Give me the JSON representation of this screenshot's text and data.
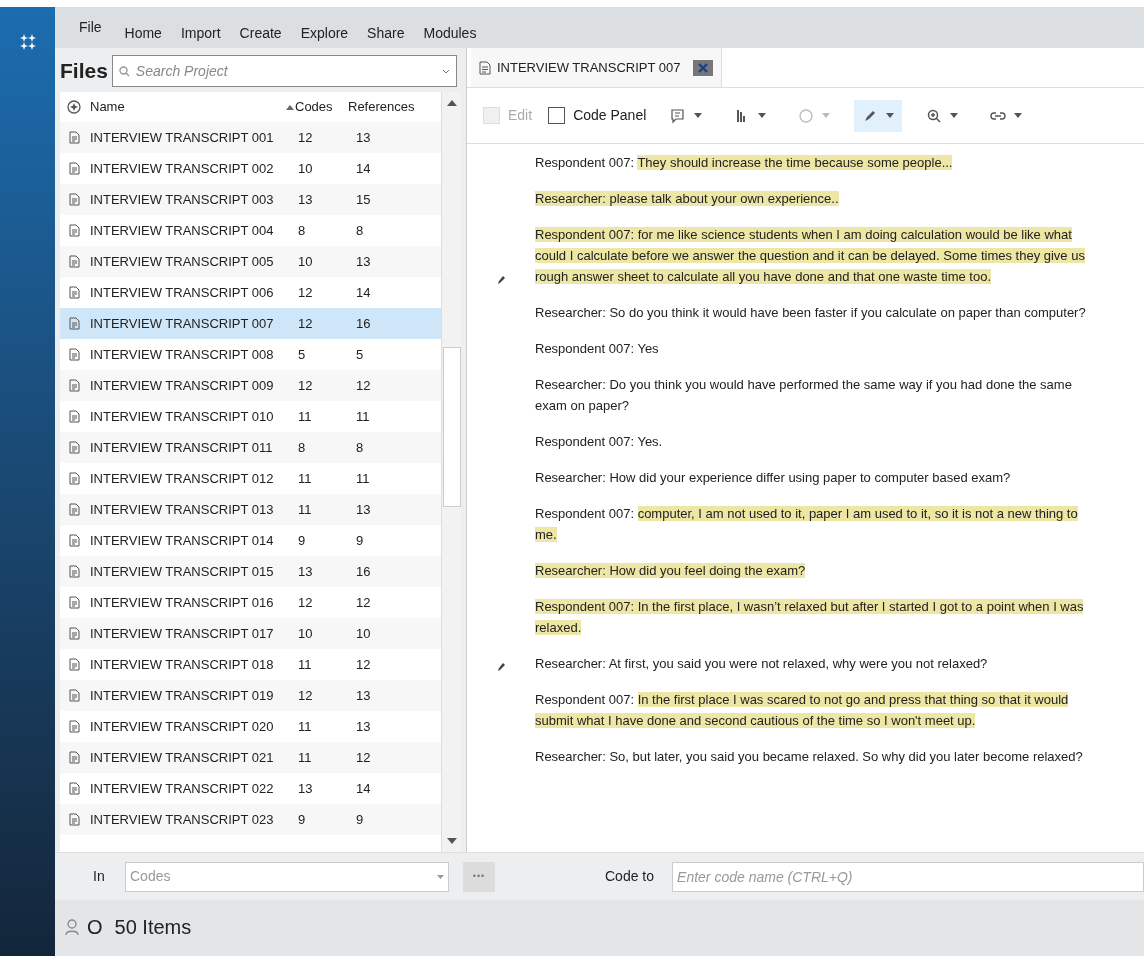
{
  "menu": [
    "File",
    "Home",
    "Import",
    "Create",
    "Explore",
    "Share",
    "Modules"
  ],
  "files": {
    "title": "Files",
    "search": {
      "placeholder": "Search Project"
    },
    "columns": [
      {
        "label": "Name",
        "sorted": false
      },
      {
        "label": "Codes",
        "sorted": true
      },
      {
        "label": "References",
        "sorted": false
      }
    ],
    "rows": [
      {
        "name": "INTERVIEW TRANSCRIPT 001",
        "codes": "12",
        "references": "13",
        "selected": false
      },
      {
        "name": "INTERVIEW TRANSCRIPT 002",
        "codes": "10",
        "references": "14",
        "selected": false
      },
      {
        "name": "INTERVIEW TRANSCRIPT 003",
        "codes": "13",
        "references": "15",
        "selected": false
      },
      {
        "name": "INTERVIEW TRANSCRIPT 004",
        "codes": "8",
        "references": "8",
        "selected": false
      },
      {
        "name": "INTERVIEW TRANSCRIPT 005",
        "codes": "10",
        "references": "13",
        "selected": false
      },
      {
        "name": "INTERVIEW TRANSCRIPT 006",
        "codes": "12",
        "references": "14",
        "selected": false
      },
      {
        "name": "INTERVIEW TRANSCRIPT 007",
        "codes": "12",
        "references": "16",
        "selected": true
      },
      {
        "name": "INTERVIEW TRANSCRIPT 008",
        "codes": "5",
        "references": "5",
        "selected": false
      },
      {
        "name": "INTERVIEW TRANSCRIPT 009",
        "codes": "12",
        "references": "12",
        "selected": false
      },
      {
        "name": "INTERVIEW TRANSCRIPT 010",
        "codes": "11",
        "references": "11",
        "selected": false
      },
      {
        "name": "INTERVIEW TRANSCRIPT 011",
        "codes": "8",
        "references": "8",
        "selected": false
      },
      {
        "name": "INTERVIEW TRANSCRIPT 012",
        "codes": "11",
        "references": "11",
        "selected": false
      },
      {
        "name": "INTERVIEW TRANSCRIPT 013",
        "codes": "11",
        "references": "13",
        "selected": false
      },
      {
        "name": "INTERVIEW TRANSCRIPT 014",
        "codes": "9",
        "references": "9",
        "selected": false
      },
      {
        "name": "INTERVIEW TRANSCRIPT 015",
        "codes": "13",
        "references": "16",
        "selected": false
      },
      {
        "name": "INTERVIEW TRANSCRIPT 016",
        "codes": "12",
        "references": "12",
        "selected": false
      },
      {
        "name": "INTERVIEW TRANSCRIPT 017",
        "codes": "10",
        "references": "10",
        "selected": false
      },
      {
        "name": "INTERVIEW TRANSCRIPT 018",
        "codes": "11",
        "references": "12",
        "selected": false
      },
      {
        "name": "INTERVIEW TRANSCRIPT 019",
        "codes": "12",
        "references": "13",
        "selected": false
      },
      {
        "name": "INTERVIEW TRANSCRIPT 020",
        "codes": "11",
        "references": "13",
        "selected": false
      },
      {
        "name": "INTERVIEW TRANSCRIPT 021",
        "codes": "11",
        "references": "12",
        "selected": false
      },
      {
        "name": "INTERVIEW TRANSCRIPT 022",
        "codes": "13",
        "references": "14",
        "selected": false
      },
      {
        "name": "INTERVIEW TRANSCRIPT 023",
        "codes": "9",
        "references": "9",
        "selected": false
      }
    ]
  },
  "document_tab": {
    "title": "INTERVIEW TRANSCRIPT 007",
    "selected": true
  },
  "toolbar": {
    "edit": {
      "label": "Edit",
      "checked": false,
      "disabled": true
    },
    "code_panel": {
      "label": "Code Panel",
      "checked": false
    },
    "tools": [
      {
        "kind": "memo",
        "disabled": false,
        "selected": false
      },
      {
        "kind": "stripes",
        "disabled": false,
        "selected": false
      },
      {
        "kind": "circle",
        "disabled": true,
        "selected": false
      },
      {
        "kind": "highlight",
        "disabled": false,
        "selected": true
      },
      {
        "kind": "zoom",
        "disabled": false,
        "selected": false
      },
      {
        "kind": "link",
        "disabled": false,
        "selected": false
      }
    ]
  },
  "paragraphs": [
    {
      "annotated": false,
      "segments": [
        {
          "text": "Respondent 007: ",
          "highlighted": false
        },
        {
          "text": "They should increase the time because some people...",
          "highlighted": true
        }
      ]
    },
    {
      "annotated": false,
      "segments": [
        {
          "text": "Researcher: please talk about your own experience..",
          "highlighted": true
        }
      ]
    },
    {
      "annotated": true,
      "segments": [
        {
          "text": " Respondent 007: for me like science students when I am doing calculation would be like what could I calculate before we answer the question and it can be delayed. Some times they give us rough answer sheet to calculate all you have done and that one waste time too.",
          "highlighted": true
        }
      ]
    },
    {
      "annotated": false,
      "segments": [
        {
          "text": "Researcher: So do you think it would have been faster if you calculate on paper than computer?",
          "highlighted": false
        }
      ]
    },
    {
      "annotated": false,
      "segments": [
        {
          "text": "Respondent 007: Yes",
          "highlighted": false
        }
      ]
    },
    {
      "annotated": false,
      "segments": [
        {
          "text": " Researcher: Do you think you would have performed the same way if you had done the same exam on paper?",
          "highlighted": false
        }
      ]
    },
    {
      "annotated": false,
      "segments": [
        {
          "text": "Respondent 007: Yes.",
          "highlighted": false
        }
      ]
    },
    {
      "annotated": false,
      "segments": [
        {
          "text": "Researcher: How did your experience differ using paper to computer based exam?",
          "highlighted": false
        }
      ]
    },
    {
      "annotated": false,
      "segments": [
        {
          "text": "Respondent 007: ",
          "highlighted": false
        },
        {
          "text": "computer, I am not used to it, paper I am used to it, so it is not a new thing to me.",
          "highlighted": true
        }
      ]
    },
    {
      "annotated": false,
      "segments": [
        {
          "text": "Researcher: How did you feel doing the exam?",
          "highlighted": true
        }
      ]
    },
    {
      "annotated": false,
      "segments": [
        {
          "text": " Respondent 007: In the first place, I wasn’t relaxed but after I started I got to a point when I was relaxed.",
          "highlighted": true
        }
      ]
    },
    {
      "annotated": true,
      "segments": [
        {
          "text": "Researcher: At first, you said you were not relaxed, why were you not relaxed?",
          "highlighted": false
        }
      ]
    },
    {
      "annotated": false,
      "segments": [
        {
          "text": "Respondent 007: ",
          "highlighted": false
        },
        {
          "text": "In the first place I was scared to not go and press that thing so that  it would submit what I have done and second cautious of the time so I won't meet up.",
          "highlighted": true
        }
      ]
    },
    {
      "annotated": false,
      "segments": [
        {
          "text": "Researcher: So, but later, you said you became relaxed. So why did you later become relaxed?",
          "highlighted": false
        }
      ]
    }
  ],
  "coding_bar": {
    "in_label": "In",
    "in_placeholder": "Codes",
    "more": "•••",
    "code_to_label": "Code to",
    "code_to_placeholder": "Enter code name (CTRL+Q)"
  },
  "status_bar": {
    "user": "O",
    "items": "50 Items"
  }
}
